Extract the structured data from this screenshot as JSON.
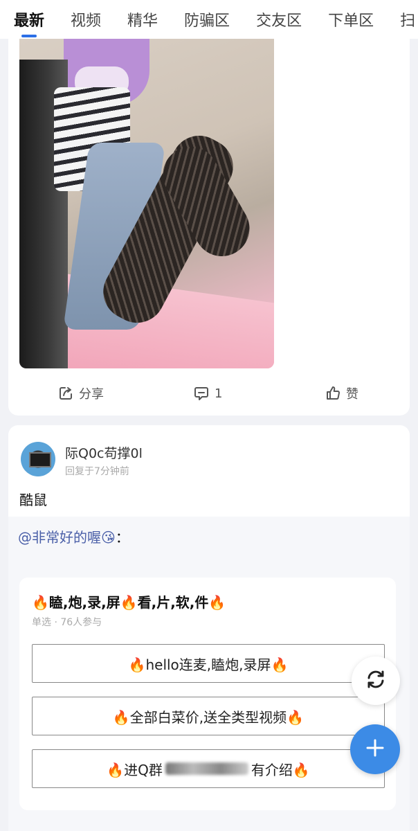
{
  "tabs": [
    {
      "label": "最新",
      "active": true
    },
    {
      "label": "视频",
      "active": false
    },
    {
      "label": "精华",
      "active": false
    },
    {
      "label": "防骗区",
      "active": false
    },
    {
      "label": "交友区",
      "active": false
    },
    {
      "label": "下单区",
      "active": false
    },
    {
      "label": "扫",
      "active": false
    }
  ],
  "post1": {
    "actions": {
      "share_label": "分享",
      "comment_count": "1",
      "like_label": "赞"
    }
  },
  "post2": {
    "user_name": "际Q0c苟撑0l",
    "time": "回复于7分钟前",
    "title": "酷鼠",
    "mention": "@非常好的喔😘",
    "mention_suffix": "：",
    "poll": {
      "title": "🔥瞌,炮,录,屏🔥看,片,软,件🔥",
      "meta": "单选 · 76人参与",
      "options": [
        {
          "pre": "🔥hello连麦,瞌炮,录屏🔥",
          "post": ""
        },
        {
          "pre": "🔥全部白菜价,送全类型视频🔥",
          "post": ""
        },
        {
          "pre": "🔥进Q群",
          "post": "有介绍🔥"
        }
      ]
    }
  },
  "colors": {
    "accent": "#2b6fe6",
    "fab": "#3c8be6",
    "mention": "#4a5fa8"
  },
  "icons": {
    "share": "share-icon",
    "comment": "comment-icon",
    "like": "thumbs-up-icon",
    "refresh": "refresh-icon",
    "add": "plus-icon"
  }
}
